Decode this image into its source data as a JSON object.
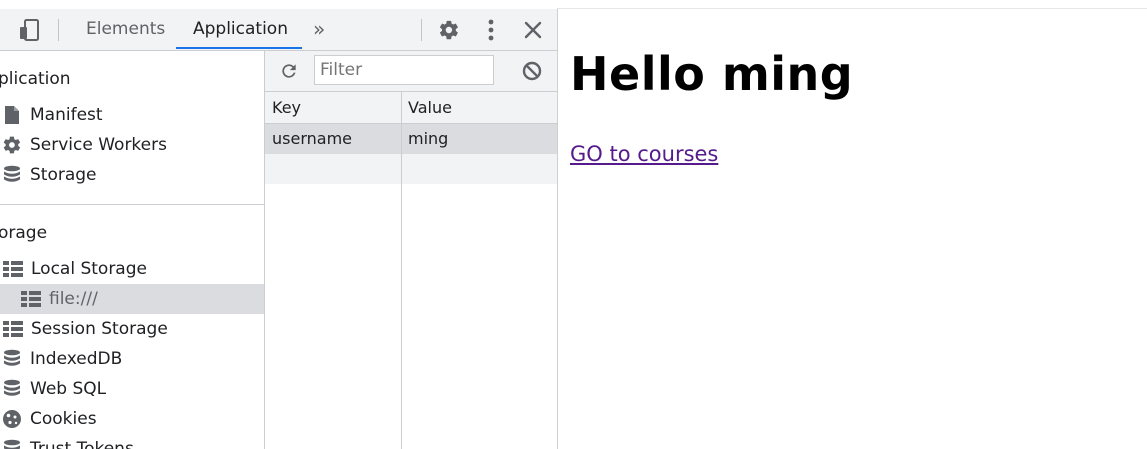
{
  "devtools": {
    "tabs": [
      {
        "label": "Elements"
      },
      {
        "label": "Application",
        "active": true
      }
    ],
    "more_tabs_glyph": "»",
    "icons": {
      "device_toggle": "device-toggle-icon",
      "settings": "gear-icon",
      "more": "vertical-ellipsis-icon",
      "close": "close-icon"
    },
    "accent_color": "#1a73e8",
    "sidebar": {
      "sections": [
        {
          "title": "plication",
          "items": [
            {
              "label": "Manifest",
              "icon": "file-icon"
            },
            {
              "label": "Service Workers",
              "icon": "gear-icon"
            },
            {
              "label": "Storage",
              "icon": "database-icon"
            }
          ]
        },
        {
          "title": "orage",
          "items": [
            {
              "label": "Local Storage",
              "icon": "grid-icon"
            },
            {
              "label": "file:///",
              "icon": "grid-icon",
              "selected": true
            },
            {
              "label": "Session Storage",
              "icon": "grid-icon"
            },
            {
              "label": "IndexedDB",
              "icon": "database-icon"
            },
            {
              "label": "Web SQL",
              "icon": "database-icon"
            },
            {
              "label": "Cookies",
              "icon": "cookie-icon"
            },
            {
              "label": "Trust Tokens",
              "icon": "database-icon"
            }
          ]
        }
      ]
    },
    "storage_table": {
      "filter_placeholder": "Filter",
      "columns": [
        "Key",
        "Value"
      ],
      "rows": [
        {
          "key": "username",
          "value": "ming"
        }
      ]
    }
  },
  "page": {
    "heading": "Hello ming",
    "link_text": "GO to courses",
    "link_color": "#551a8b"
  }
}
